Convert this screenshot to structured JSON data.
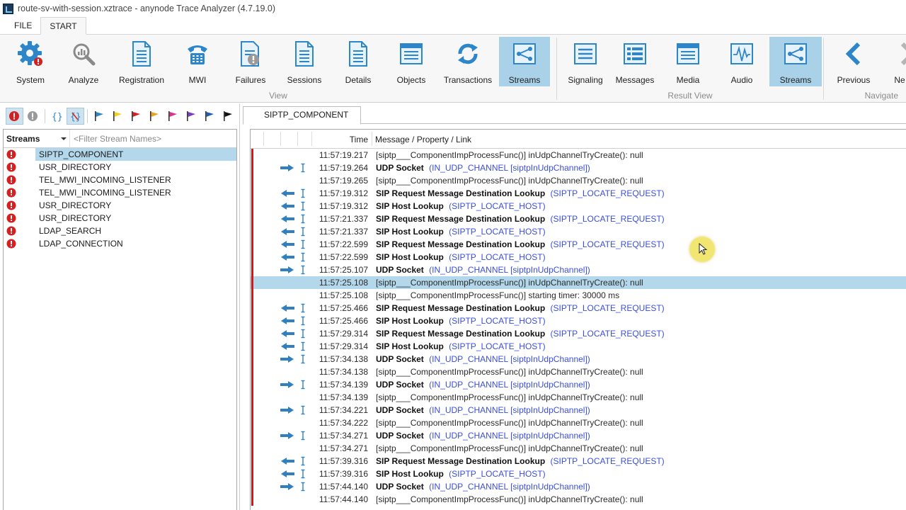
{
  "window": {
    "title": "route-sv-with-session.xztrace - anynode Trace Analyzer (4.7.19.0)"
  },
  "ribbon_tabs": [
    {
      "label": "FILE"
    },
    {
      "label": "START"
    }
  ],
  "ribbon": {
    "view_group": {
      "label": "View",
      "buttons": [
        {
          "label": "System",
          "icon": "gear-icon"
        },
        {
          "label": "Analyze",
          "icon": "analyze-icon"
        },
        {
          "label": "Registration",
          "icon": "document-icon"
        },
        {
          "label": "MWI",
          "icon": "phone-icon"
        },
        {
          "label": "Failures",
          "icon": "failures-icon"
        },
        {
          "label": "Sessions",
          "icon": "document-icon"
        },
        {
          "label": "Details",
          "icon": "document-icon"
        },
        {
          "label": "Objects",
          "icon": "objects-icon"
        },
        {
          "label": "Transactions",
          "icon": "refresh-icon"
        },
        {
          "label": "Streams",
          "icon": "streams-icon"
        }
      ]
    },
    "result_group": {
      "label": "Result View",
      "buttons": [
        {
          "label": "Signaling",
          "icon": "signaling-icon"
        },
        {
          "label": "Messages",
          "icon": "messages-icon"
        },
        {
          "label": "Media",
          "icon": "media-icon"
        },
        {
          "label": "Audio",
          "icon": "audio-icon"
        },
        {
          "label": "Streams",
          "icon": "streams-icon"
        }
      ]
    },
    "navigate_group": {
      "label": "Navigate",
      "buttons": [
        {
          "label": "Previous",
          "icon": "chevron-left-icon"
        },
        {
          "label": "Ne",
          "icon": "chevron-right-icon"
        }
      ]
    }
  },
  "left_panel": {
    "combo_label": "Streams",
    "filter_placeholder": "<Filter Stream Names>",
    "streams": [
      "SIPTP_COMPONENT",
      "USR_DIRECTORY",
      "TEL_MWI_INCOMING_LISTENER",
      "TEL_MWI_INCOMING_LISTENER",
      "USR_DIRECTORY",
      "USR_DIRECTORY",
      "LDAP_SEARCH",
      "LDAP_CONNECTION"
    ]
  },
  "doc_tab": {
    "label": "SIPTP_COMPONENT"
  },
  "grid": {
    "columns": {
      "time": "Time",
      "message": "Message / Property / Link"
    },
    "rows": [
      {
        "dir": "",
        "time": "11:57:19.217",
        "bold": "",
        "text": "[siptp___ComponentImpProcessFunc()] inUdpChannelTryCreate(): null",
        "link": ""
      },
      {
        "dir": "right",
        "time": "11:57:19.264",
        "bold": "UDP Socket",
        "text": "",
        "link": "(IN_UDP_CHANNEL [siptpInUdpChannel])"
      },
      {
        "dir": "",
        "time": "11:57:19.265",
        "bold": "",
        "text": "[siptp___ComponentImpProcessFunc()] inUdpChannelTryCreate(): null",
        "link": ""
      },
      {
        "dir": "left",
        "time": "11:57:19.312",
        "bold": "SIP Request Message Destination Lookup",
        "text": "",
        "link": "(SIPTP_LOCATE_REQUEST)"
      },
      {
        "dir": "left",
        "time": "11:57:19.312",
        "bold": "SIP Host Lookup",
        "text": "",
        "link": "(SIPTP_LOCATE_HOST)"
      },
      {
        "dir": "left",
        "time": "11:57:21.337",
        "bold": "SIP Request Message Destination Lookup",
        "text": "",
        "link": "(SIPTP_LOCATE_REQUEST)"
      },
      {
        "dir": "left",
        "time": "11:57:21.337",
        "bold": "SIP Host Lookup",
        "text": "",
        "link": "(SIPTP_LOCATE_HOST)"
      },
      {
        "dir": "left",
        "time": "11:57:22.599",
        "bold": "SIP Request Message Destination Lookup",
        "text": "",
        "link": "(SIPTP_LOCATE_REQUEST)"
      },
      {
        "dir": "left",
        "time": "11:57:22.599",
        "bold": "SIP Host Lookup",
        "text": "",
        "link": "(SIPTP_LOCATE_HOST)"
      },
      {
        "dir": "right",
        "time": "11:57:25.107",
        "bold": "UDP Socket",
        "text": "",
        "link": "(IN_UDP_CHANNEL [siptpInUdpChannel])"
      },
      {
        "dir": "",
        "time": "11:57:25.108",
        "bold": "",
        "text": "[siptp___ComponentImpProcessFunc()] inUdpChannelTryCreate(): null",
        "link": "",
        "selected": true
      },
      {
        "dir": "",
        "time": "11:57:25.108",
        "bold": "",
        "text": "[siptp___ComponentImpProcessFunc()] starting timer: 30000 ms",
        "link": ""
      },
      {
        "dir": "left",
        "time": "11:57:25.466",
        "bold": "SIP Request Message Destination Lookup",
        "text": "",
        "link": "(SIPTP_LOCATE_REQUEST)"
      },
      {
        "dir": "left",
        "time": "11:57:25.466",
        "bold": "SIP Host Lookup",
        "text": "",
        "link": "(SIPTP_LOCATE_HOST)"
      },
      {
        "dir": "left",
        "time": "11:57:29.314",
        "bold": "SIP Request Message Destination Lookup",
        "text": "",
        "link": "(SIPTP_LOCATE_REQUEST)"
      },
      {
        "dir": "left",
        "time": "11:57:29.314",
        "bold": "SIP Host Lookup",
        "text": "",
        "link": "(SIPTP_LOCATE_HOST)"
      },
      {
        "dir": "right",
        "time": "11:57:34.138",
        "bold": "UDP Socket",
        "text": "",
        "link": "(IN_UDP_CHANNEL [siptpInUdpChannel])"
      },
      {
        "dir": "",
        "time": "11:57:34.138",
        "bold": "",
        "text": "[siptp___ComponentImpProcessFunc()] inUdpChannelTryCreate(): null",
        "link": ""
      },
      {
        "dir": "right",
        "time": "11:57:34.139",
        "bold": "UDP Socket",
        "text": "",
        "link": "(IN_UDP_CHANNEL [siptpInUdpChannel])"
      },
      {
        "dir": "",
        "time": "11:57:34.139",
        "bold": "",
        "text": "[siptp___ComponentImpProcessFunc()] inUdpChannelTryCreate(): null",
        "link": ""
      },
      {
        "dir": "right",
        "time": "11:57:34.221",
        "bold": "UDP Socket",
        "text": "",
        "link": "(IN_UDP_CHANNEL [siptpInUdpChannel])"
      },
      {
        "dir": "",
        "time": "11:57:34.222",
        "bold": "",
        "text": "[siptp___ComponentImpProcessFunc()] inUdpChannelTryCreate(): null",
        "link": ""
      },
      {
        "dir": "right",
        "time": "11:57:34.271",
        "bold": "UDP Socket",
        "text": "",
        "link": "(IN_UDP_CHANNEL [siptpInUdpChannel])"
      },
      {
        "dir": "",
        "time": "11:57:34.271",
        "bold": "",
        "text": "[siptp___ComponentImpProcessFunc()] inUdpChannelTryCreate(): null",
        "link": ""
      },
      {
        "dir": "left",
        "time": "11:57:39.316",
        "bold": "SIP Request Message Destination Lookup",
        "text": "",
        "link": "(SIPTP_LOCATE_REQUEST)"
      },
      {
        "dir": "left",
        "time": "11:57:39.316",
        "bold": "SIP Host Lookup",
        "text": "",
        "link": "(SIPTP_LOCATE_HOST)"
      },
      {
        "dir": "right",
        "time": "11:57:44.140",
        "bold": "UDP Socket",
        "text": "",
        "link": "(IN_UDP_CHANNEL [siptpInUdpChannel])"
      },
      {
        "dir": "",
        "time": "11:57:44.140",
        "bold": "",
        "text": "[siptp___ComponentImpProcessFunc()] inUdpChannelTryCreate(): null",
        "link": ""
      }
    ]
  },
  "colors": {
    "accent_blue": "#2f7fc1",
    "selection": "#b4d8eb",
    "active_button": "#a9d2e8",
    "link": "#3a4fd8",
    "error_red": "#d01818"
  }
}
